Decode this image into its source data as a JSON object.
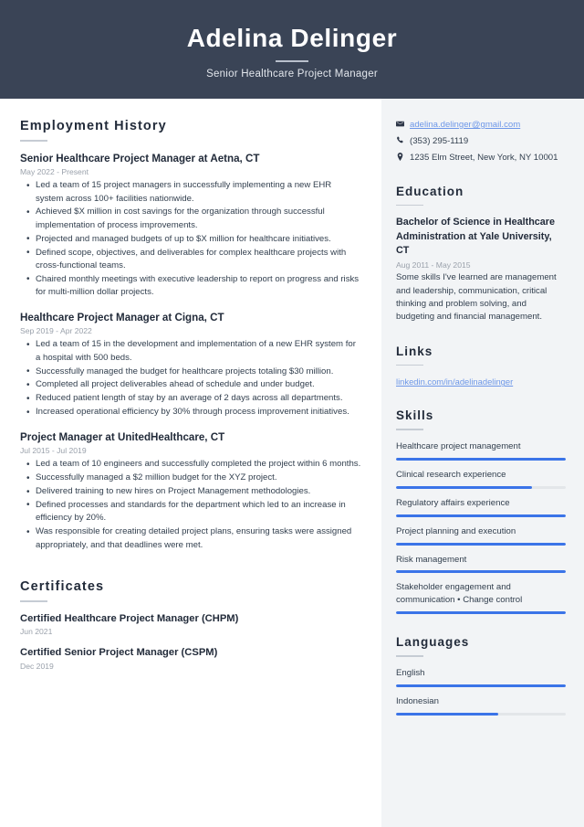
{
  "header": {
    "name": "Adelina Delinger",
    "title": "Senior Healthcare Project Manager",
    "background_color": "#3a4456"
  },
  "theme": {
    "accent_blue": "#3b74e8",
    "link_blue": "#6d97e8",
    "dark_text": "#222b3a",
    "muted_text": "#9aa1ab",
    "sidebar_background": "#f2f4f6"
  },
  "main": {
    "employment": {
      "heading": "Employment History",
      "entries": [
        {
          "title": "Senior Healthcare Project Manager at Aetna, CT",
          "date": "May 2022 - Present",
          "bullets": [
            "Led a team of 15 project managers in successfully implementing a new EHR system across 100+ facilities nationwide.",
            "Achieved $X million in cost savings for the organization through successful implementation of process improvements.",
            "Projected and managed budgets of up to $X million for healthcare initiatives.",
            "Defined scope, objectives, and deliverables for complex healthcare projects with cross-functional teams.",
            "Chaired monthly meetings with executive leadership to report on progress and risks for multi-million dollar projects."
          ]
        },
        {
          "title": "Healthcare Project Manager at Cigna, CT",
          "date": "Sep 2019 - Apr 2022",
          "bullets": [
            "Led a team of 15 in the development and implementation of a new EHR system for a hospital with 500 beds.",
            "Successfully managed the budget for healthcare projects totaling $30 million.",
            "Completed all project deliverables ahead of schedule and under budget.",
            "Reduced patient length of stay by an average of 2 days across all departments.",
            "Increased operational efficiency by 30% through process improvement initiatives."
          ]
        },
        {
          "title": "Project Manager at UnitedHealthcare, CT",
          "date": "Jul 2015 - Jul 2019",
          "bullets": [
            "Led a team of 10 engineers and successfully completed the project within 6 months.",
            "Successfully managed a $2 million budget for the XYZ project.",
            "Delivered training to new hires on Project Management methodologies.",
            "Defined processes and standards for the department which led to an increase in efficiency by 20%.",
            "Was responsible for creating detailed project plans, ensuring tasks were assigned appropriately, and that deadlines were met."
          ]
        }
      ]
    },
    "certificates": {
      "heading": "Certificates",
      "entries": [
        {
          "title": "Certified Healthcare Project Manager (CHPM)",
          "date": "Jun 2021"
        },
        {
          "title": "Certified Senior Project Manager (CSPM)",
          "date": "Dec 2019"
        }
      ]
    }
  },
  "sidebar": {
    "contact": [
      {
        "icon": "envelope-icon",
        "text": "adelina.delinger@gmail.com",
        "is_link": true
      },
      {
        "icon": "phone-icon",
        "text": "(353) 295-1119",
        "is_link": false
      },
      {
        "icon": "location-pin-icon",
        "text": "1235 Elm Street, New York, NY 10001",
        "is_link": false
      }
    ],
    "education": {
      "heading": "Education",
      "entry": {
        "title": "Bachelor of Science in Healthcare Administration at Yale University, CT",
        "date": "Aug 2011 - May 2015",
        "description": "Some skills I've learned are management and leadership, communication, critical thinking and problem solving, and budgeting and financial management."
      }
    },
    "links": {
      "heading": "Links",
      "items": [
        {
          "label": "linkedin.com/in/adelinadelinger"
        }
      ]
    },
    "skills": {
      "heading": "Skills",
      "items": [
        {
          "label": "Healthcare project management",
          "level": 100
        },
        {
          "label": "Clinical research experience",
          "level": 80
        },
        {
          "label": "Regulatory affairs experience",
          "level": 100
        },
        {
          "label": "Project planning and execution",
          "level": 100
        },
        {
          "label": "Risk management",
          "level": 100
        },
        {
          "label": "Stakeholder engagement and communication • Change control",
          "level": 100
        }
      ]
    },
    "languages": {
      "heading": "Languages",
      "items": [
        {
          "label": "English",
          "level": 100
        },
        {
          "label": "Indonesian",
          "level": 60
        }
      ]
    }
  }
}
